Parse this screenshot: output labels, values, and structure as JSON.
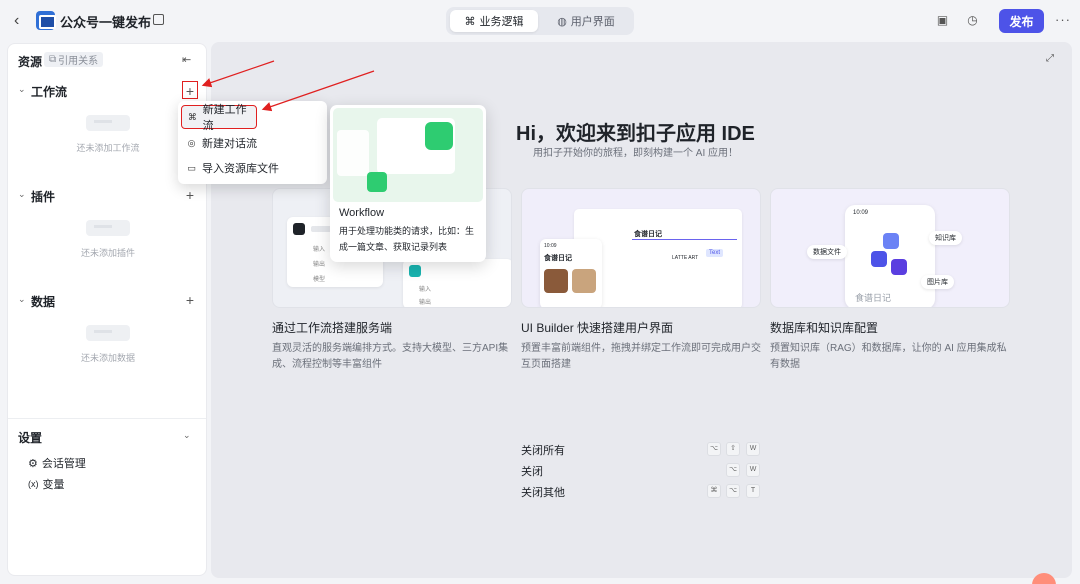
{
  "header": {
    "title": "公众号一键发布",
    "tabs": [
      {
        "label": "业务逻辑",
        "icon": "workflow-icon",
        "active": true
      },
      {
        "label": "用户界面",
        "icon": "palette-icon",
        "active": false
      }
    ],
    "publish_label": "发布",
    "accent_color": "#4d53e8"
  },
  "sidebar": {
    "title": "资源",
    "ref_chip": "引用关系",
    "sections": [
      {
        "label": "工作流",
        "empty_text": "还未添加工作流"
      },
      {
        "label": "插件",
        "empty_text": "还未添加插件"
      },
      {
        "label": "数据",
        "empty_text": "还未添加数据"
      }
    ],
    "settings": {
      "label": "设置",
      "items": [
        {
          "label": "会话管理",
          "icon": "chat-settings-icon"
        },
        {
          "label": "变量",
          "icon": "variable-icon"
        }
      ]
    }
  },
  "add_menu": {
    "items": [
      {
        "label": "新建工作流",
        "icon": "workflow-icon"
      },
      {
        "label": "新建对话流",
        "icon": "chatflow-icon"
      },
      {
        "label": "导入资源库文件",
        "icon": "import-icon"
      }
    ]
  },
  "tooltip": {
    "title": "Workflow",
    "description": "用于处理功能类的请求，比如：生成一篇文章、获取记录列表"
  },
  "main": {
    "welcome_title": "Hi，欢迎来到扣子应用 IDE",
    "welcome_subtitle": "用扣子开始你的旅程，即刻构建一个 AI 应用！",
    "cards": [
      {
        "title": "通过工作流搭建服务端",
        "description": "直观灵活的服务端编排方式。支持大模型、三方API集成、流程控制等丰富组件"
      },
      {
        "title": "UI Builder 快速搭建用户界面",
        "description": "预置丰富前端组件，拖拽并绑定工作流即可完成用户交互页面搭建"
      },
      {
        "title": "数据库和知识库配置",
        "description": "预置知识库（RAG）和数据库，让你的 AI 应用集成私有数据"
      }
    ],
    "card_art": {
      "form_labels": [
        "输入",
        "输出",
        "模型"
      ],
      "form_labels_lower": [
        "输入",
        "输出"
      ],
      "ui_heading": "食谱日记",
      "ui_time": "10:09",
      "ui_latte": "LATTE ART",
      "ui_chip": "Text",
      "kb_time": "10:09",
      "kb_tags": [
        "数据文件",
        "知识库",
        "图片库"
      ],
      "kb_caption": "食谱日记"
    },
    "shortcuts": [
      {
        "label": "关闭所有",
        "keys": [
          "⌥",
          "⇧",
          "W"
        ]
      },
      {
        "label": "关闭",
        "keys": [
          "⌥",
          "W"
        ]
      },
      {
        "label": "关闭其他",
        "keys": [
          "⌘",
          "⌥",
          "T"
        ]
      }
    ]
  }
}
